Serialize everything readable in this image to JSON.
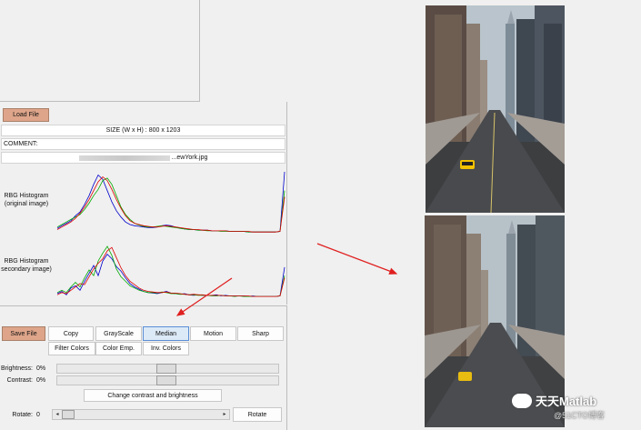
{
  "panel": {
    "load_label": "Load File",
    "size_text": "SIZE (W x H) : 800 x 1203",
    "comment_label": "COMMENT:",
    "file_name": "...ewYork.jpg"
  },
  "histograms": {
    "original_label_1": "RBG Histogram",
    "original_label_2": "(original image)",
    "secondary_label_1": "RBG Histogram",
    "secondary_label_2": "secondary image)"
  },
  "chart_data": [
    {
      "type": "line",
      "title": "",
      "x": [
        0,
        1,
        2,
        3,
        4,
        5,
        6,
        7,
        8,
        9,
        10,
        11,
        12,
        13,
        14,
        15,
        16,
        17,
        18,
        19,
        20,
        21,
        22,
        23,
        24,
        25,
        26,
        27,
        28,
        29,
        30,
        31,
        32,
        33,
        34,
        35,
        36,
        37,
        38,
        39,
        40,
        41,
        42,
        43,
        44,
        45,
        46,
        47,
        48,
        49,
        50
      ],
      "series": [
        {
          "color": "#0000cc",
          "values": [
            10,
            14,
            18,
            22,
            30,
            36,
            48,
            62,
            80,
            95,
            88,
            70,
            52,
            38,
            28,
            20,
            16,
            14,
            13,
            12,
            11,
            11,
            12,
            14,
            15,
            14,
            12,
            10,
            9,
            8,
            8,
            7,
            7,
            7,
            6,
            6,
            6,
            6,
            5,
            5,
            5,
            5,
            4,
            4,
            4,
            4,
            4,
            4,
            4,
            5,
            100
          ]
        },
        {
          "color": "#00aa00",
          "values": [
            12,
            16,
            20,
            24,
            28,
            32,
            40,
            50,
            62,
            72,
            86,
            90,
            80,
            62,
            44,
            32,
            24,
            18,
            15,
            13,
            12,
            12,
            13,
            14,
            13,
            12,
            11,
            10,
            9,
            8,
            8,
            7,
            7,
            6,
            6,
            6,
            5,
            5,
            5,
            5,
            5,
            5,
            4,
            4,
            4,
            4,
            4,
            4,
            4,
            5,
            70
          ]
        },
        {
          "color": "#dd0000",
          "values": [
            8,
            12,
            16,
            20,
            26,
            34,
            44,
            56,
            70,
            84,
            92,
            86,
            72,
            56,
            42,
            30,
            22,
            18,
            16,
            14,
            13,
            12,
            12,
            13,
            14,
            13,
            12,
            11,
            10,
            9,
            8,
            8,
            7,
            7,
            6,
            6,
            6,
            6,
            5,
            5,
            5,
            5,
            5,
            4,
            4,
            4,
            4,
            4,
            4,
            5,
            60
          ]
        }
      ]
    },
    {
      "type": "line",
      "title": "",
      "x": [
        0,
        1,
        2,
        3,
        4,
        5,
        6,
        7,
        8,
        9,
        10,
        11,
        12,
        13,
        14,
        15,
        16,
        17,
        18,
        19,
        20,
        21,
        22,
        23,
        24,
        25,
        26,
        27,
        28,
        29,
        30,
        31,
        32,
        33,
        34,
        35,
        36,
        37,
        38,
        39,
        40,
        41,
        42,
        43,
        44,
        45,
        46,
        47,
        48,
        49,
        50
      ],
      "series": [
        {
          "color": "#0000cc",
          "values": [
            8,
            12,
            6,
            18,
            22,
            14,
            30,
            44,
            58,
            40,
            66,
            78,
            70,
            56,
            48,
            36,
            26,
            20,
            16,
            12,
            10,
            9,
            8,
            10,
            12,
            9,
            8,
            7,
            8,
            6,
            5,
            6,
            5,
            5,
            5,
            6,
            4,
            5,
            4,
            4,
            4,
            4,
            3,
            4,
            3,
            3,
            3,
            3,
            3,
            4,
            55
          ]
        },
        {
          "color": "#00aa00",
          "values": [
            10,
            14,
            10,
            20,
            28,
            20,
            36,
            50,
            40,
            66,
            80,
            92,
            76,
            52,
            38,
            30,
            22,
            18,
            14,
            12,
            10,
            10,
            9,
            11,
            10,
            8,
            8,
            7,
            7,
            6,
            6,
            5,
            5,
            5,
            4,
            4,
            5,
            4,
            4,
            3,
            4,
            3,
            3,
            3,
            3,
            3,
            3,
            3,
            3,
            4,
            40
          ]
        },
        {
          "color": "#dd0000",
          "values": [
            6,
            10,
            8,
            14,
            20,
            26,
            24,
            38,
            52,
            62,
            70,
            84,
            90,
            72,
            54,
            40,
            30,
            24,
            18,
            14,
            12,
            11,
            10,
            10,
            11,
            9,
            9,
            8,
            7,
            6,
            7,
            6,
            6,
            5,
            5,
            5,
            5,
            4,
            4,
            4,
            4,
            4,
            4,
            3,
            3,
            3,
            3,
            3,
            3,
            4,
            36
          ]
        }
      ]
    }
  ],
  "buttons": {
    "save_label": "Save File",
    "copy_label": "Copy",
    "grayscale_label": "GrayScale",
    "median_label": "Median",
    "motion_label": "Motion",
    "sharp_label": "Sharp",
    "filter_label": "Filter Colors",
    "color_emp_label": "Color Emp.",
    "inv_colors_label": "Inv. Colors",
    "contrast_btn_label": "Change contrast and brightness",
    "rotate_btn_label": "Rotate"
  },
  "sliders": {
    "brightness_label": "Brightness:",
    "brightness_value": "0%",
    "contrast_label": "Contrast:",
    "contrast_value": "0%",
    "rotate_label": "Rotate:",
    "rotate_value": "0"
  },
  "watermark": {
    "title": "天天Matlab",
    "sub": "@51CTO博客"
  },
  "colors": {
    "arrow": "#e02020",
    "accent_button": "#dea58a"
  }
}
